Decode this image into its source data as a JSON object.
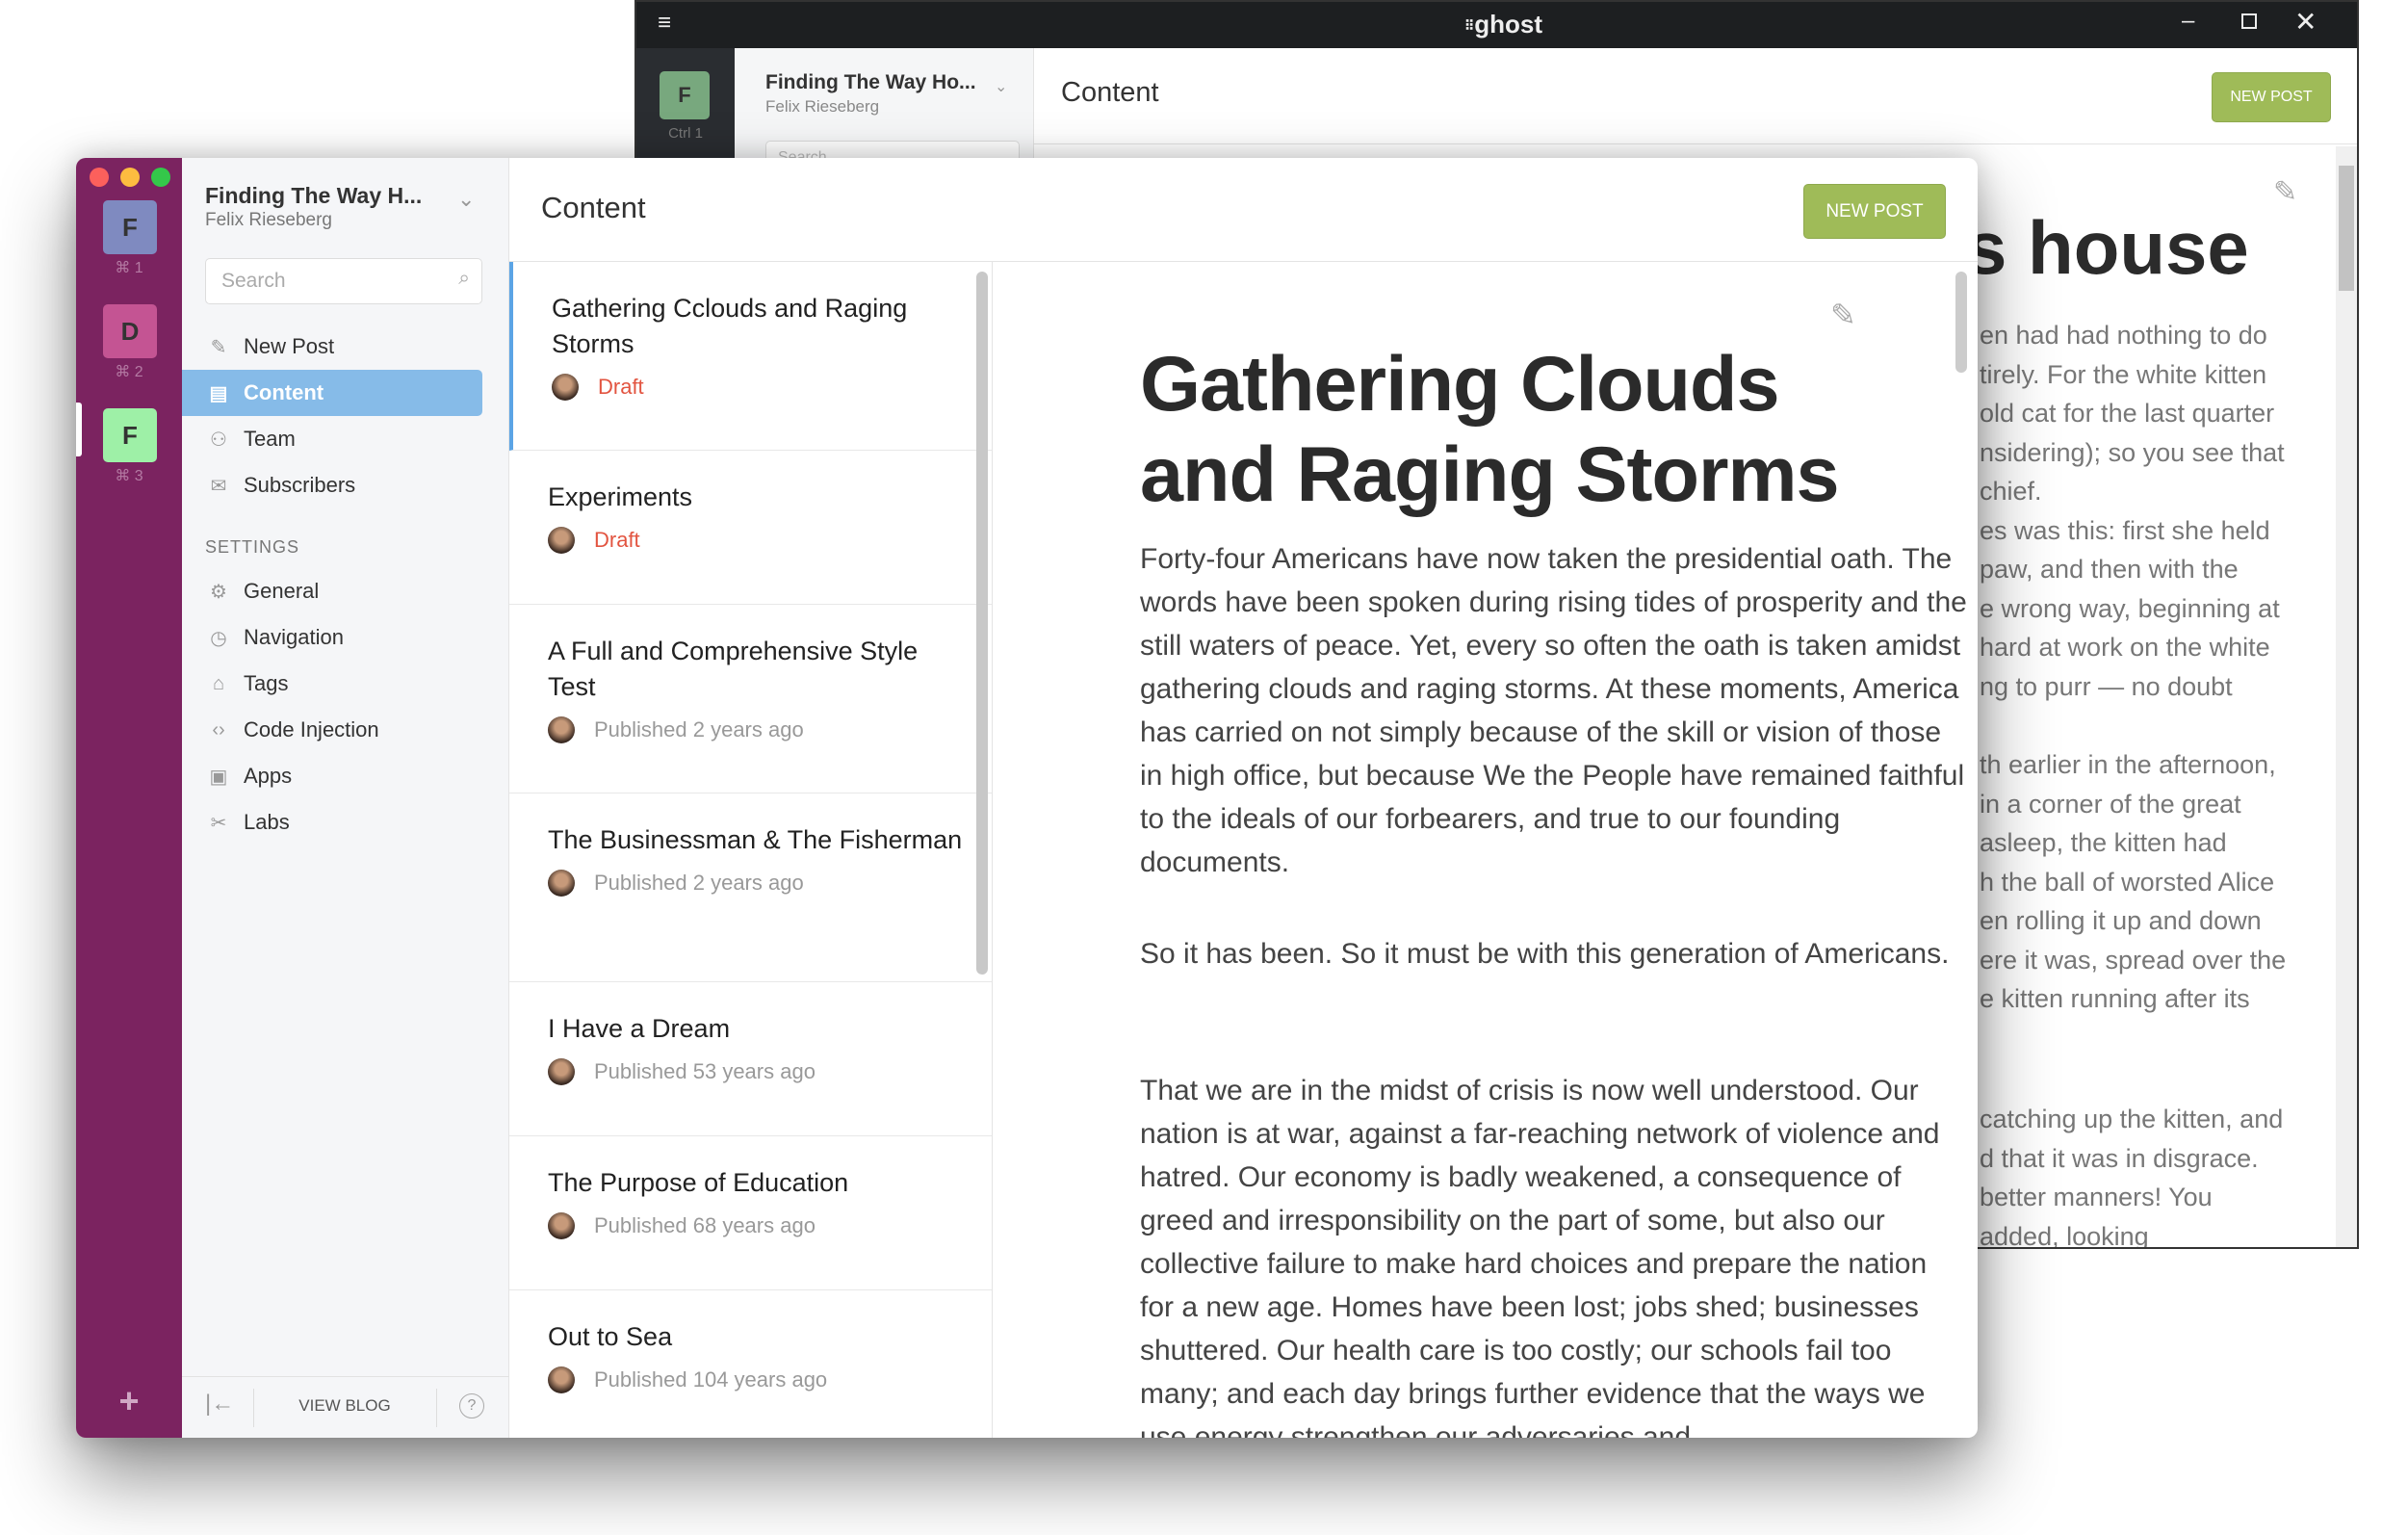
{
  "back_window": {
    "app_logo": "ghost",
    "workspace": {
      "letter": "F",
      "shortcut": "Ctrl 1"
    },
    "blog_title": "Finding The Way Ho...",
    "user": "Felix Rieseberg",
    "search_placeholder": "Search",
    "header_title": "Content",
    "new_post": "NEW POST",
    "article_title_fragment": "s house",
    "article_lines": [
      [
        "en had had nothing to do",
        "tirely. For the white kitten",
        "old cat for the last quarter",
        "nsidering); so you see that",
        "chief.",
        "es was this: first she held",
        "paw, and then with the",
        "e wrong way, beginning at",
        " hard at work on the white",
        "ng to purr — no doubt"
      ],
      [
        "th earlier in the afternoon,",
        "in a corner of the great",
        "asleep, the kitten had",
        "h the ball of worsted Alice",
        "en rolling it up and down",
        "ere it was, spread over the",
        "e kitten running after its"
      ],
      [
        "catching up the kitten, and",
        "d that it was in disgrace.",
        "better manners! You",
        " added, looking"
      ]
    ]
  },
  "front_window": {
    "workspaces": [
      {
        "letter": "F",
        "shortcut": "⌘ 1",
        "color": "#7f8ac0"
      },
      {
        "letter": "D",
        "shortcut": "⌘ 2",
        "color": "#c45493"
      },
      {
        "letter": "F",
        "shortcut": "⌘ 3",
        "color": "#9ef0a7"
      }
    ],
    "blog_title": "Finding The Way H...",
    "user": "Felix Rieseberg",
    "search_placeholder": "Search",
    "nav": [
      {
        "label": "New Post",
        "icon": "pencil-icon"
      },
      {
        "label": "Content",
        "icon": "content-icon",
        "active": true
      },
      {
        "label": "Team",
        "icon": "team-icon"
      },
      {
        "label": "Subscribers",
        "icon": "envelope-icon"
      }
    ],
    "settings_heading": "SETTINGS",
    "settings": [
      {
        "label": "General",
        "icon": "gear-icon"
      },
      {
        "label": "Navigation",
        "icon": "compass-icon"
      },
      {
        "label": "Tags",
        "icon": "tag-icon"
      },
      {
        "label": "Code Injection",
        "icon": "code-icon"
      },
      {
        "label": "Apps",
        "icon": "box-icon"
      },
      {
        "label": "Labs",
        "icon": "tools-icon"
      }
    ],
    "footer": {
      "view_blog": "VIEW BLOG"
    },
    "header_title": "Content",
    "new_post": "NEW POST",
    "posts": [
      {
        "title": "Gathering Cclouds and Raging Storms",
        "status": "Draft",
        "draft": true
      },
      {
        "title": "Experiments",
        "status": "Draft",
        "draft": true
      },
      {
        "title": "A Full and Comprehensive Style Test",
        "status": "Published 2 years ago"
      },
      {
        "title": "The Businessman & The Fisherman",
        "status": "Published 2 years ago"
      },
      {
        "title": "I Have a Dream",
        "status": "Published 53 years ago"
      },
      {
        "title": "The Purpose of Education",
        "status": "Published 68 years ago"
      },
      {
        "title": "Out to Sea",
        "status": "Published 104 years ago"
      }
    ],
    "article": {
      "title": "Gathering Clouds and Raging Storms",
      "paragraphs": [
        "Forty-four Americans have now taken the presidential oath. The words have been spoken during rising tides of prosperity and the still waters of peace. Yet, every so often the oath is taken amidst gathering clouds and raging storms. At these moments, America has carried on not simply because of the skill or vision of those in high office, but because We the People have remained faithful to the ideals of our forbearers, and true to our founding documents.",
        "So it has been. So it must be with this generation of Americans.",
        "That we are in the midst of crisis is now well understood. Our nation is at war, against a far-reaching network of violence and hatred. Our economy is badly weakened, a consequence of greed and irresponsibility on the part of some, but also our collective failure to make hard choices and prepare the nation for a new age. Homes have been lost; jobs shed; businesses shuttered. Our health care is too costly; our schools fail too many; and each day brings further evidence that the ways we use energy strengthen our adversaries and"
      ]
    },
    "colors": {
      "rail": "#7b2360",
      "accent": "#86bbe8",
      "new_post": "#9fbb58",
      "draft": "#e25440"
    }
  }
}
